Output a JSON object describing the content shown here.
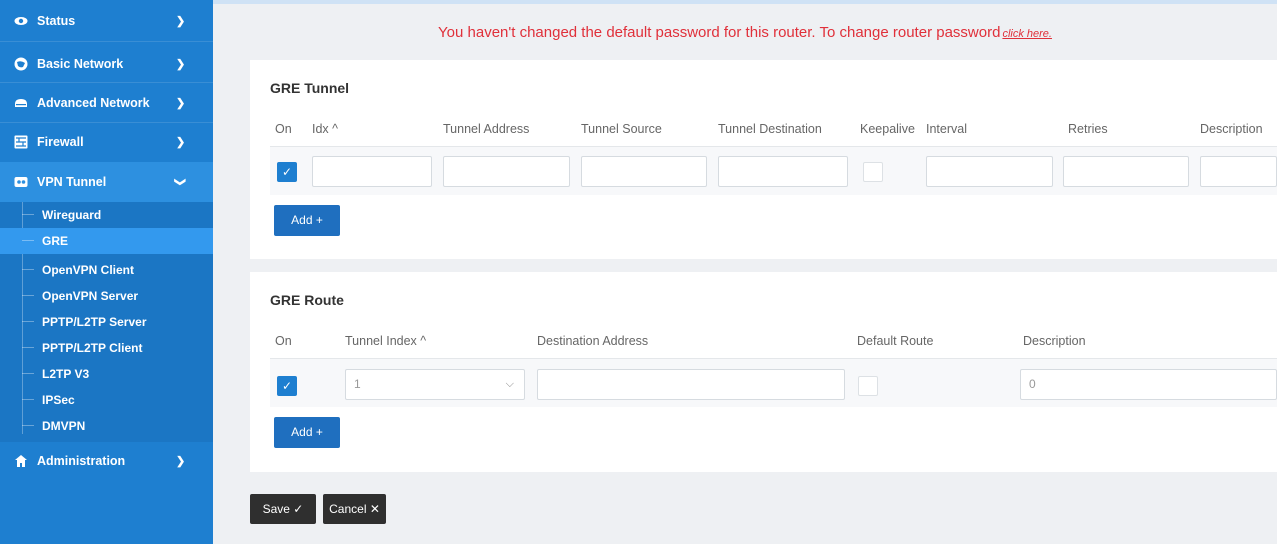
{
  "sidebar": {
    "items": [
      {
        "label": "Status",
        "icon": "eye-icon"
      },
      {
        "label": "Basic Network",
        "icon": "globe-icon"
      },
      {
        "label": "Advanced Network",
        "icon": "cloud-icon"
      },
      {
        "label": "Firewall",
        "icon": "firewall-icon"
      },
      {
        "label": "VPN Tunnel",
        "icon": "vpn-icon"
      },
      {
        "label": "Administration",
        "icon": "admin-icon"
      }
    ],
    "submenu": [
      "Wireguard",
      "GRE",
      "OpenVPN Client",
      "OpenVPN Server",
      "PPTP/L2TP Server",
      "PPTP/L2TP Client",
      "L2TP V3",
      "IPSec",
      "DMVPN"
    ],
    "active_sub": "GRE"
  },
  "warning": {
    "text": "You haven't changed the default password for this router. To change router password",
    "link": "click here."
  },
  "gre_tunnel": {
    "title": "GRE Tunnel",
    "columns": [
      "On",
      "Idx ^",
      "Tunnel Address",
      "Tunnel Source",
      "Tunnel Destination",
      "Keepalive",
      "Interval",
      "Retries",
      "Description"
    ],
    "add_label": "Add +"
  },
  "gre_route": {
    "title": "GRE Route",
    "columns": [
      "On",
      "Tunnel Index ^",
      "Destination Address",
      "Default Route",
      "Description"
    ],
    "tunnel_index_value": "1",
    "description_placeholder": "0",
    "add_label": "Add +"
  },
  "actions": {
    "save_label": "Save ✓",
    "cancel_label": "Cancel ✕"
  },
  "colors": {
    "sidebar": "#1e7fd0",
    "accent": "#1f6fbf",
    "warning": "#e0303a"
  }
}
